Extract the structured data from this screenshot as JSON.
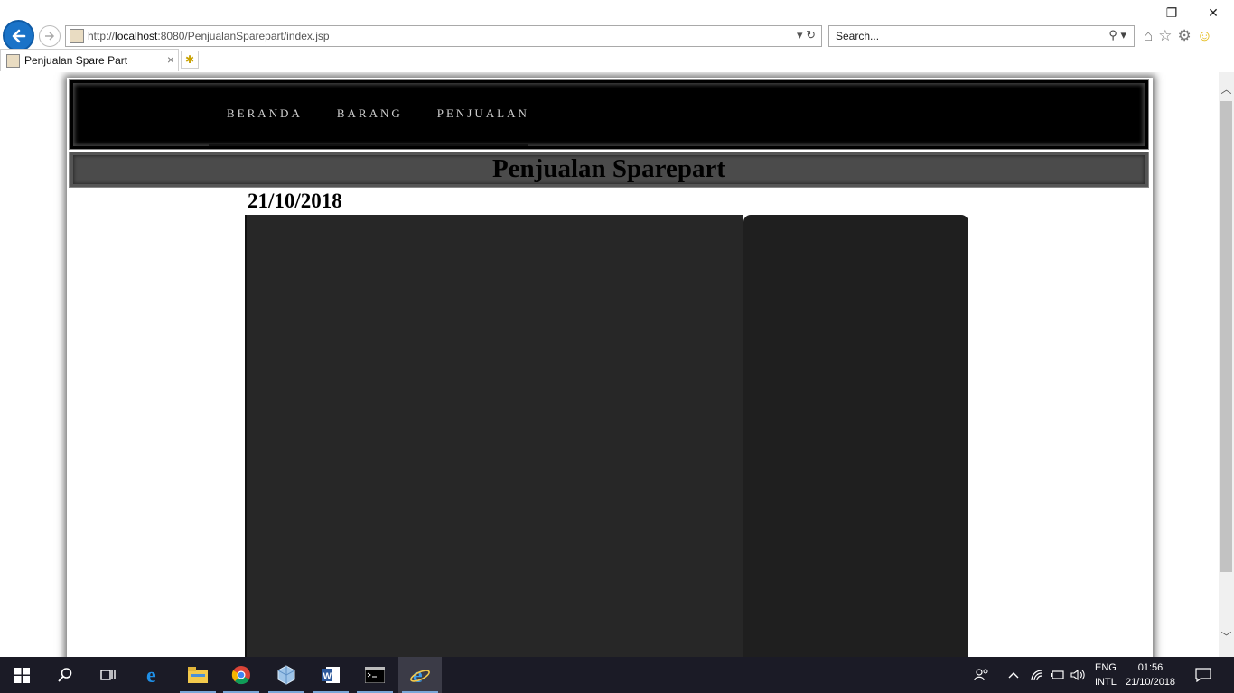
{
  "browser": {
    "url_prefix": "http://",
    "url_host": "localhost",
    "url_rest": ":8080/PenjualanSparepart/index.jsp",
    "search_placeholder": "Search...",
    "tab_title": "Penjualan Spare Part",
    "window_controls": {
      "minimize": "—",
      "restore": "❐",
      "close": "✕"
    }
  },
  "page": {
    "nav": [
      "BERANDA",
      "BARANG",
      "PENJUALAN"
    ],
    "title": "Penjualan Sparepart",
    "date": "21/10/2018"
  },
  "taskbar": {
    "lang_top": "ENG",
    "lang_bottom": "INTL",
    "time": "01:56",
    "date": "21/10/2018",
    "apps": [
      "start-icon",
      "search-icon",
      "task-view-icon",
      "edge-icon",
      "file-explorer-icon",
      "chrome-icon",
      "virtualbox-icon",
      "word-icon",
      "cmd-icon",
      "internet-explorer-icon"
    ]
  },
  "colors": {
    "header_bg": "#000000",
    "titlebar_bg": "#4b4b4b",
    "content_main": "#272727",
    "content_side": "#1f1f1f",
    "taskbar": "#1b1b26"
  }
}
